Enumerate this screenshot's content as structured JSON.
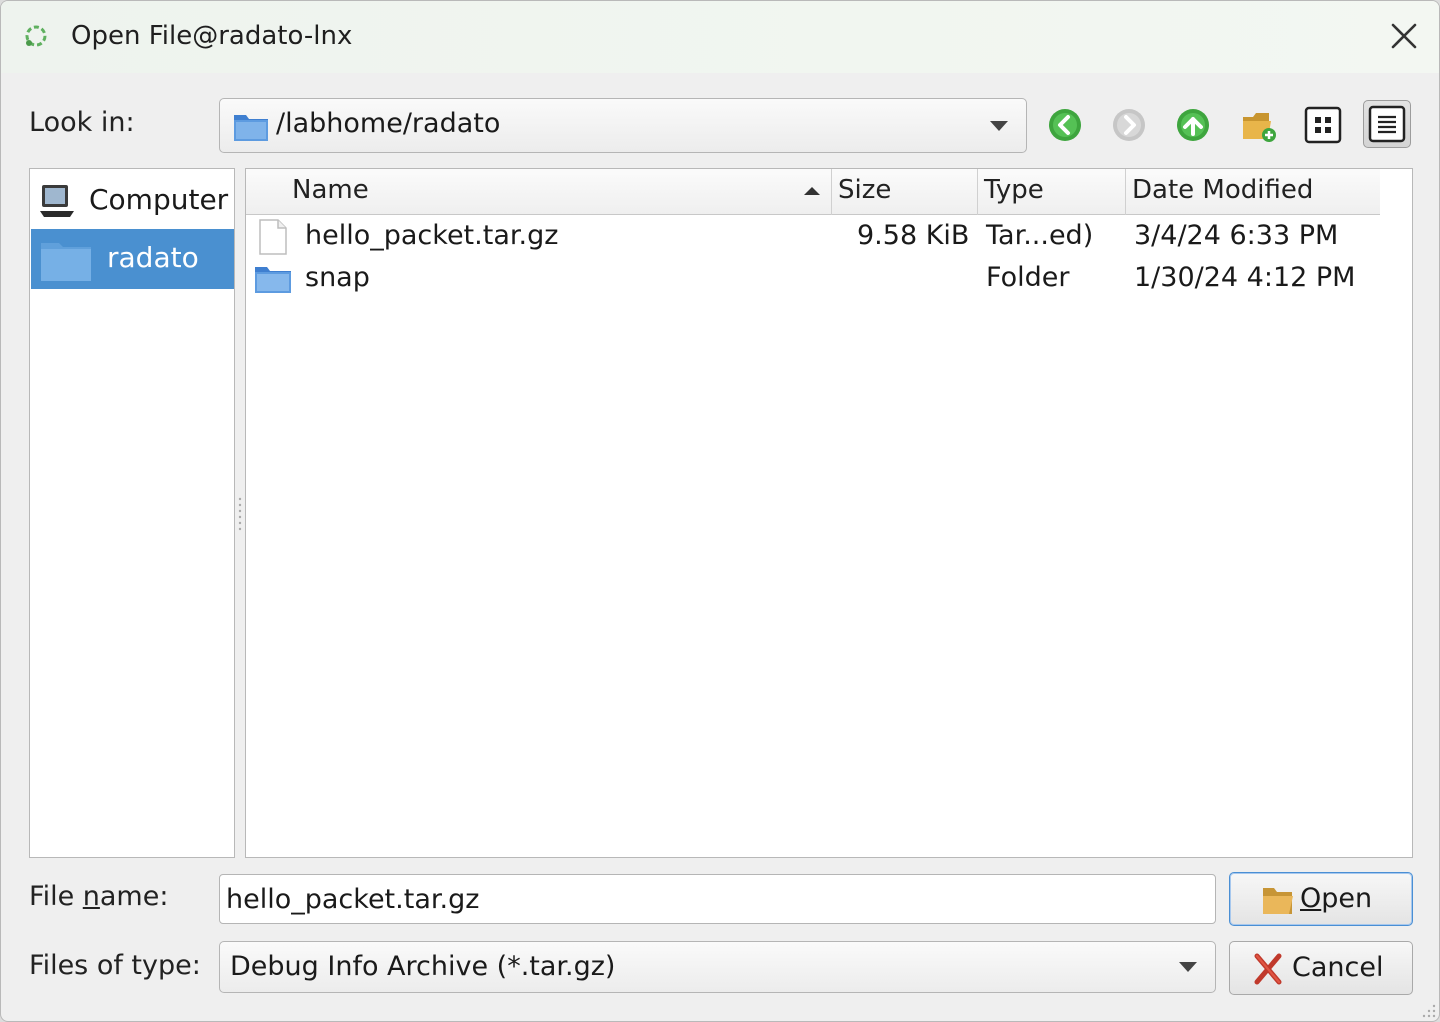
{
  "window": {
    "title": "Open File@radato-lnx"
  },
  "toolbar": {
    "look_in_label": "Look in:",
    "path": "/labhome/radato",
    "buttons": [
      "back-icon",
      "forward-icon",
      "up-icon",
      "new-folder-icon",
      "icon-view-icon",
      "detail-view-icon"
    ]
  },
  "sidebar": {
    "items": [
      {
        "label": "Computer",
        "icon": "computer-icon"
      },
      {
        "label": "radato",
        "icon": "folder-icon",
        "selected": true
      }
    ]
  },
  "files": {
    "columns": [
      "Name",
      "Size",
      "Type",
      "Date Modified"
    ],
    "sort_column": "Name",
    "rows": [
      {
        "name": "hello_packet.tar.gz",
        "size": "9.58 KiB",
        "type": "Tar...ed)",
        "modified": "3/4/24 6:33 PM",
        "icon": "file-icon"
      },
      {
        "name": "snap",
        "size": "",
        "type": "Folder",
        "modified": "1/30/24 4:12 PM",
        "icon": "folder-icon"
      }
    ]
  },
  "bottom": {
    "filename_label_pre": "File ",
    "filename_label_mnemonic": "n",
    "filename_label_post": "ame:",
    "filename_value": "hello_packet.tar.gz",
    "filetype_label": "Files of type:",
    "filetype_value": "Debug Info Archive (*.tar.gz)",
    "open_mnemonic": "O",
    "open_rest": "pen",
    "cancel_label": "Cancel"
  },
  "colors": {
    "selection": "#4a90d0",
    "accent_green": "#3aa83a",
    "default_button_border": "#4a8fd4"
  }
}
